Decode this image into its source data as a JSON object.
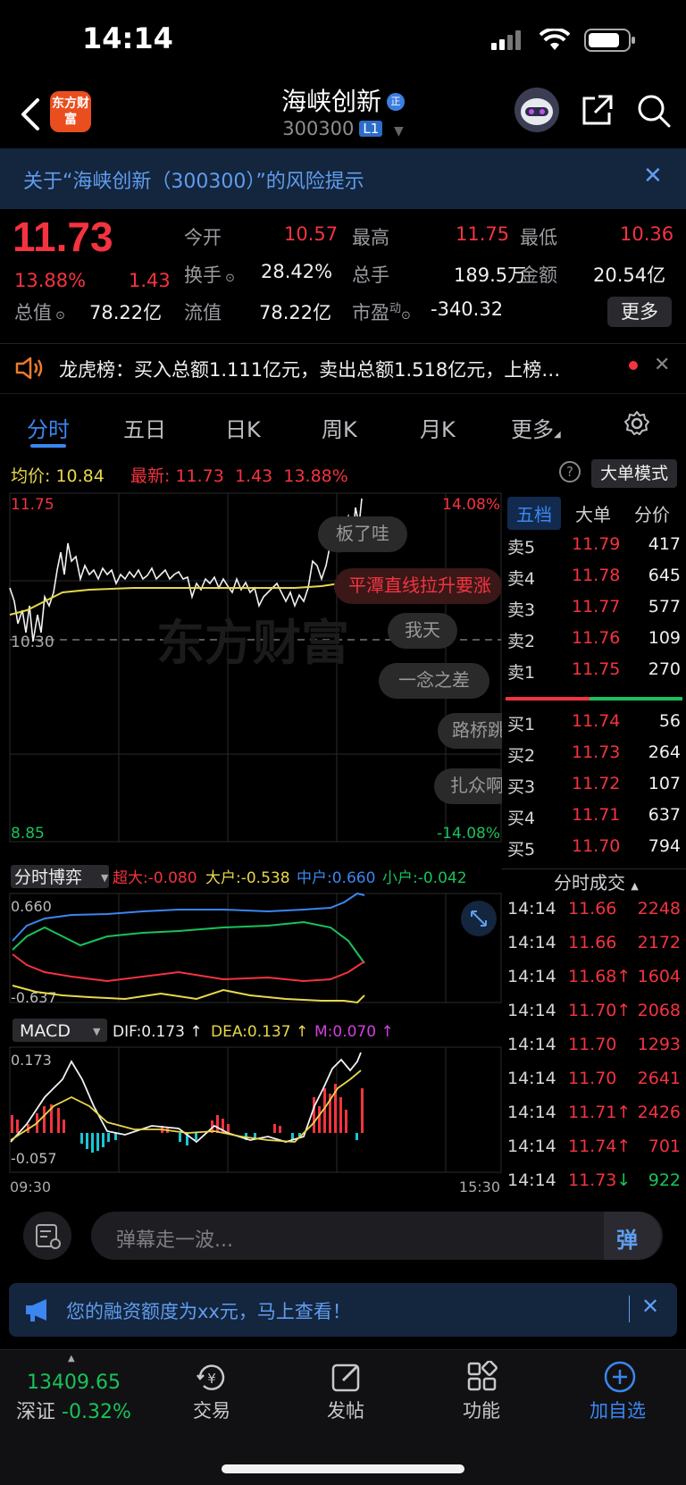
{
  "status_bar": {
    "time": "14:14"
  },
  "header": {
    "brand_logo": "东方财富",
    "stock_name": "海峡创新",
    "stock_code": "300300",
    "level_badge": "L1",
    "reg_badge": "正"
  },
  "risk_banner": {
    "text": "关于“海峡创新（300300）”的风险提示"
  },
  "quote": {
    "price": "11.73",
    "change_pct": "13.88%",
    "change": "1.43",
    "open_label": "今开",
    "open": "10.57",
    "high_label": "最高",
    "high": "11.75",
    "low_label": "最低",
    "low": "10.36",
    "turnover_label": "换手",
    "turnover": "28.42%",
    "volume_label": "总手",
    "volume": "189.5万",
    "amount_label": "金额",
    "amount": "20.54亿",
    "total_value_label": "总值",
    "total_value": "78.22亿",
    "float_value_label": "流值",
    "float_value": "78.22亿",
    "pe_label": "市盈",
    "pe_sup": "动",
    "pe": "-340.32",
    "more_label": "更多"
  },
  "dragon_tiger": {
    "text": "龙虎榜：买入总额1.111亿元，卖出总额1.518亿元，上榜…"
  },
  "tabs": [
    "分时",
    "五日",
    "日K",
    "周K",
    "月K",
    "更多"
  ],
  "info_bar": {
    "avg_label": "均价:",
    "avg": "10.84",
    "latest_label": "最新:",
    "latest": "11.73",
    "latest_change": "1.43",
    "latest_pct": "13.88%",
    "mode_button": "大单模式"
  },
  "chart_labels": {
    "price_top": "11.75",
    "price_mid": "10.30",
    "price_bottom": "8.85",
    "pct_top": "14.08%",
    "pct_bottom": "-14.08%",
    "watermark": "东方财富",
    "time_start": "09:30",
    "time_end": "15:30"
  },
  "danmaku": [
    "板了哇",
    "平潭直线拉升要涨",
    "我天",
    "一念之差",
    "路桥跳",
    "扎众啊"
  ],
  "game_panel": {
    "title": "分时博弈",
    "super_large": "超大:-0.080",
    "large": "大户:-0.538",
    "medium": "中户:0.660",
    "small": "小户:-0.042",
    "top": "0.660",
    "bottom": "-0.637"
  },
  "macd_panel": {
    "title": "MACD",
    "dif": "DIF:0.173 ↑",
    "dea": "DEA:0.137 ↑",
    "m": "M:0.070 ↑",
    "top": "0.173",
    "bottom": "-0.057"
  },
  "order_book": {
    "tabs": [
      "五档",
      "大单",
      "分价"
    ],
    "asks": [
      {
        "label": "卖5",
        "price": "11.79",
        "volume": "417"
      },
      {
        "label": "卖4",
        "price": "11.78",
        "volume": "645"
      },
      {
        "label": "卖3",
        "price": "11.77",
        "volume": "577"
      },
      {
        "label": "卖2",
        "price": "11.76",
        "volume": "109"
      },
      {
        "label": "卖1",
        "price": "11.75",
        "volume": "270"
      }
    ],
    "bids": [
      {
        "label": "买1",
        "price": "11.74",
        "volume": "56"
      },
      {
        "label": "买2",
        "price": "11.73",
        "volume": "264"
      },
      {
        "label": "买3",
        "price": "11.72",
        "volume": "107"
      },
      {
        "label": "买4",
        "price": "11.71",
        "volume": "637"
      },
      {
        "label": "买5",
        "price": "11.70",
        "volume": "794"
      }
    ]
  },
  "trades": {
    "title": "分时成交",
    "rows": [
      {
        "time": "14:14",
        "price": "11.66",
        "volume": "2248",
        "dir": "",
        "vol_color": "red"
      },
      {
        "time": "14:14",
        "price": "11.66",
        "volume": "2172",
        "dir": "",
        "vol_color": "red"
      },
      {
        "time": "14:14",
        "price": "11.68",
        "volume": "1604",
        "dir": "↑",
        "vol_color": "red"
      },
      {
        "time": "14:14",
        "price": "11.70",
        "volume": "2068",
        "dir": "↑",
        "vol_color": "red"
      },
      {
        "time": "14:14",
        "price": "11.70",
        "volume": "1293",
        "dir": "",
        "vol_color": "red"
      },
      {
        "time": "14:14",
        "price": "11.70",
        "volume": "2641",
        "dir": "",
        "vol_color": "red"
      },
      {
        "time": "14:14",
        "price": "11.71",
        "volume": "2426",
        "dir": "↑",
        "vol_color": "red"
      },
      {
        "time": "14:14",
        "price": "11.74",
        "volume": "701",
        "dir": "↑",
        "vol_color": "red"
      },
      {
        "time": "14:14",
        "price": "11.73",
        "volume": "922",
        "dir": "↓",
        "vol_color": "green"
      }
    ]
  },
  "comment_bar": {
    "placeholder": "弹幕走一波...",
    "danmu_icon": "弹"
  },
  "finance_banner": {
    "text": "您的融资额度为xx元，马上查看！"
  },
  "bottom_nav": {
    "index_value": "13409.65",
    "index_name": "深证",
    "index_change": "-0.32%",
    "items": [
      "交易",
      "发帖",
      "功能",
      "加自选"
    ]
  },
  "colors": {
    "up": "#f5333f",
    "down": "#19c25a",
    "accent": "#3b86f0",
    "avg_line": "#e8d84a"
  }
}
